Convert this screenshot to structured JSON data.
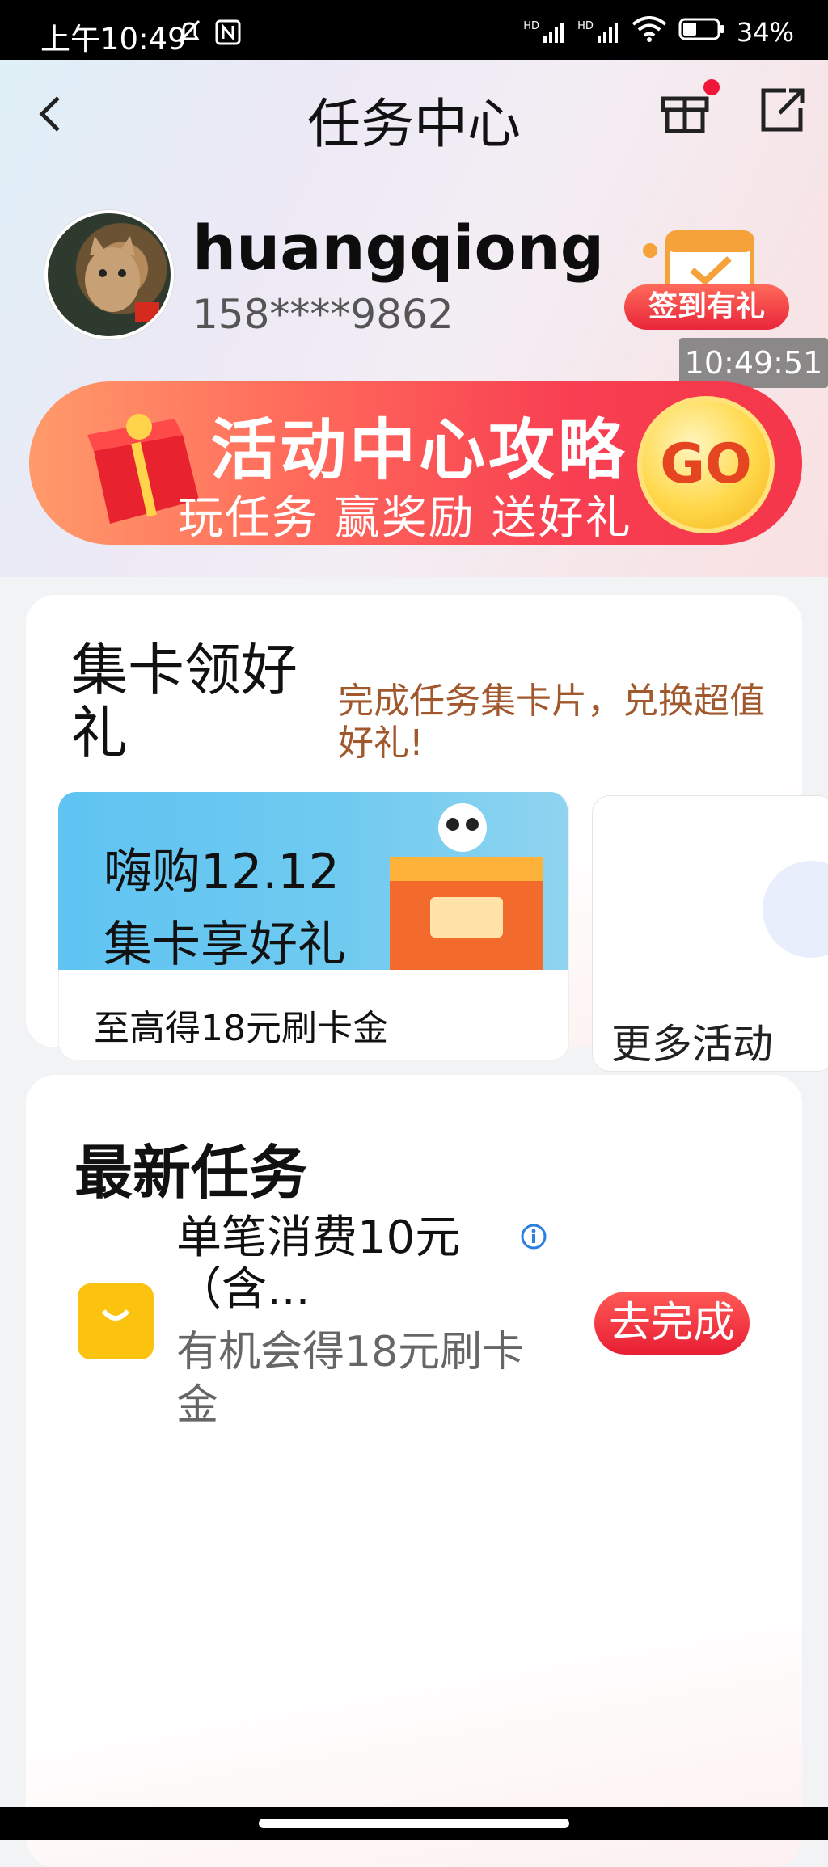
{
  "status_bar": {
    "time": "上午10:49",
    "signal_1": "HD",
    "signal_2": "HD",
    "battery": "34%"
  },
  "header": {
    "title": "任务中心"
  },
  "user": {
    "name": "huangqiong",
    "phone": "158****9862",
    "signin_label": "签到有礼",
    "overlay_time": "10:49:51"
  },
  "banner": {
    "title": "活动中心攻略",
    "subtitle": "玩任务 赢奖励 送好礼",
    "go_label": "GO"
  },
  "card_collection": {
    "title": "集卡领好礼",
    "description": "完成任务集卡片，兑换超值好礼!",
    "activity": {
      "line1": "嗨购12.12",
      "line2": "集卡享好礼",
      "caption": "至高得18元刷卡金"
    },
    "more_label": "更多活动"
  },
  "latest_tasks": {
    "title": "最新任务",
    "items": [
      {
        "name": "单笔消费10元（含...",
        "reward": "有机会得18元刷卡金",
        "action": "去完成"
      }
    ]
  },
  "colors": {
    "accent": "#f0264a",
    "link_brown": "#a0582c",
    "task_icon": "#fbc310"
  }
}
